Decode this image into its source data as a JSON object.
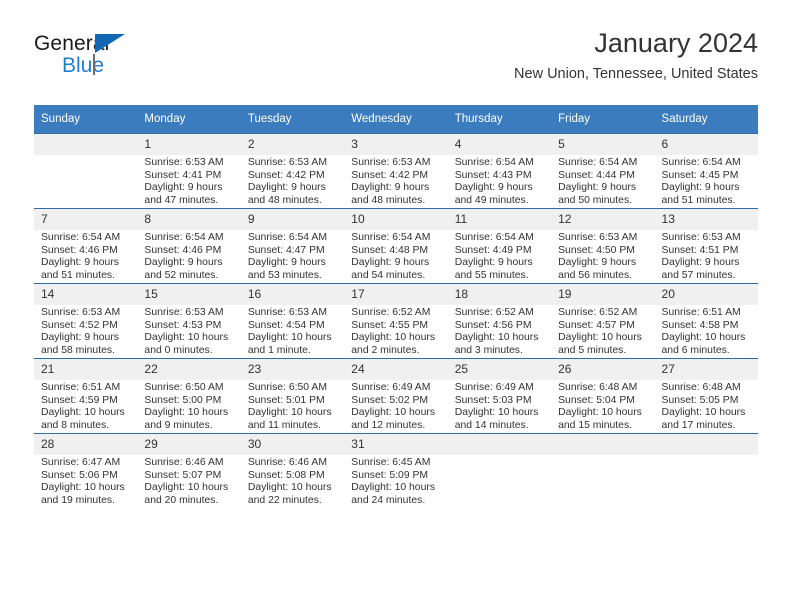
{
  "logo": {
    "word1": "General",
    "word2": "Blue",
    "triangle_color": "#1268b3",
    "blue_color": "#1f7fd0"
  },
  "header": {
    "title": "January 2024",
    "subtitle": "New Union, Tennessee, United States"
  },
  "theme": {
    "header_bg": "#3a7cbe",
    "header_text": "#ffffff",
    "daynum_bg": "#f0f0f0",
    "row_divider": "#2f6ba5",
    "body_text": "#333333"
  },
  "weekdays": [
    "Sunday",
    "Monday",
    "Tuesday",
    "Wednesday",
    "Thursday",
    "Friday",
    "Saturday"
  ],
  "weeks": [
    [
      {
        "day": "",
        "sunrise": "",
        "sunset": "",
        "daylight1": "",
        "daylight2": ""
      },
      {
        "day": "1",
        "sunrise": "Sunrise: 6:53 AM",
        "sunset": "Sunset: 4:41 PM",
        "daylight1": "Daylight: 9 hours",
        "daylight2": "and 47 minutes."
      },
      {
        "day": "2",
        "sunrise": "Sunrise: 6:53 AM",
        "sunset": "Sunset: 4:42 PM",
        "daylight1": "Daylight: 9 hours",
        "daylight2": "and 48 minutes."
      },
      {
        "day": "3",
        "sunrise": "Sunrise: 6:53 AM",
        "sunset": "Sunset: 4:42 PM",
        "daylight1": "Daylight: 9 hours",
        "daylight2": "and 48 minutes."
      },
      {
        "day": "4",
        "sunrise": "Sunrise: 6:54 AM",
        "sunset": "Sunset: 4:43 PM",
        "daylight1": "Daylight: 9 hours",
        "daylight2": "and 49 minutes."
      },
      {
        "day": "5",
        "sunrise": "Sunrise: 6:54 AM",
        "sunset": "Sunset: 4:44 PM",
        "daylight1": "Daylight: 9 hours",
        "daylight2": "and 50 minutes."
      },
      {
        "day": "6",
        "sunrise": "Sunrise: 6:54 AM",
        "sunset": "Sunset: 4:45 PM",
        "daylight1": "Daylight: 9 hours",
        "daylight2": "and 51 minutes."
      }
    ],
    [
      {
        "day": "7",
        "sunrise": "Sunrise: 6:54 AM",
        "sunset": "Sunset: 4:46 PM",
        "daylight1": "Daylight: 9 hours",
        "daylight2": "and 51 minutes."
      },
      {
        "day": "8",
        "sunrise": "Sunrise: 6:54 AM",
        "sunset": "Sunset: 4:46 PM",
        "daylight1": "Daylight: 9 hours",
        "daylight2": "and 52 minutes."
      },
      {
        "day": "9",
        "sunrise": "Sunrise: 6:54 AM",
        "sunset": "Sunset: 4:47 PM",
        "daylight1": "Daylight: 9 hours",
        "daylight2": "and 53 minutes."
      },
      {
        "day": "10",
        "sunrise": "Sunrise: 6:54 AM",
        "sunset": "Sunset: 4:48 PM",
        "daylight1": "Daylight: 9 hours",
        "daylight2": "and 54 minutes."
      },
      {
        "day": "11",
        "sunrise": "Sunrise: 6:54 AM",
        "sunset": "Sunset: 4:49 PM",
        "daylight1": "Daylight: 9 hours",
        "daylight2": "and 55 minutes."
      },
      {
        "day": "12",
        "sunrise": "Sunrise: 6:53 AM",
        "sunset": "Sunset: 4:50 PM",
        "daylight1": "Daylight: 9 hours",
        "daylight2": "and 56 minutes."
      },
      {
        "day": "13",
        "sunrise": "Sunrise: 6:53 AM",
        "sunset": "Sunset: 4:51 PM",
        "daylight1": "Daylight: 9 hours",
        "daylight2": "and 57 minutes."
      }
    ],
    [
      {
        "day": "14",
        "sunrise": "Sunrise: 6:53 AM",
        "sunset": "Sunset: 4:52 PM",
        "daylight1": "Daylight: 9 hours",
        "daylight2": "and 58 minutes."
      },
      {
        "day": "15",
        "sunrise": "Sunrise: 6:53 AM",
        "sunset": "Sunset: 4:53 PM",
        "daylight1": "Daylight: 10 hours",
        "daylight2": "and 0 minutes."
      },
      {
        "day": "16",
        "sunrise": "Sunrise: 6:53 AM",
        "sunset": "Sunset: 4:54 PM",
        "daylight1": "Daylight: 10 hours",
        "daylight2": "and 1 minute."
      },
      {
        "day": "17",
        "sunrise": "Sunrise: 6:52 AM",
        "sunset": "Sunset: 4:55 PM",
        "daylight1": "Daylight: 10 hours",
        "daylight2": "and 2 minutes."
      },
      {
        "day": "18",
        "sunrise": "Sunrise: 6:52 AM",
        "sunset": "Sunset: 4:56 PM",
        "daylight1": "Daylight: 10 hours",
        "daylight2": "and 3 minutes."
      },
      {
        "day": "19",
        "sunrise": "Sunrise: 6:52 AM",
        "sunset": "Sunset: 4:57 PM",
        "daylight1": "Daylight: 10 hours",
        "daylight2": "and 5 minutes."
      },
      {
        "day": "20",
        "sunrise": "Sunrise: 6:51 AM",
        "sunset": "Sunset: 4:58 PM",
        "daylight1": "Daylight: 10 hours",
        "daylight2": "and 6 minutes."
      }
    ],
    [
      {
        "day": "21",
        "sunrise": "Sunrise: 6:51 AM",
        "sunset": "Sunset: 4:59 PM",
        "daylight1": "Daylight: 10 hours",
        "daylight2": "and 8 minutes."
      },
      {
        "day": "22",
        "sunrise": "Sunrise: 6:50 AM",
        "sunset": "Sunset: 5:00 PM",
        "daylight1": "Daylight: 10 hours",
        "daylight2": "and 9 minutes."
      },
      {
        "day": "23",
        "sunrise": "Sunrise: 6:50 AM",
        "sunset": "Sunset: 5:01 PM",
        "daylight1": "Daylight: 10 hours",
        "daylight2": "and 11 minutes."
      },
      {
        "day": "24",
        "sunrise": "Sunrise: 6:49 AM",
        "sunset": "Sunset: 5:02 PM",
        "daylight1": "Daylight: 10 hours",
        "daylight2": "and 12 minutes."
      },
      {
        "day": "25",
        "sunrise": "Sunrise: 6:49 AM",
        "sunset": "Sunset: 5:03 PM",
        "daylight1": "Daylight: 10 hours",
        "daylight2": "and 14 minutes."
      },
      {
        "day": "26",
        "sunrise": "Sunrise: 6:48 AM",
        "sunset": "Sunset: 5:04 PM",
        "daylight1": "Daylight: 10 hours",
        "daylight2": "and 15 minutes."
      },
      {
        "day": "27",
        "sunrise": "Sunrise: 6:48 AM",
        "sunset": "Sunset: 5:05 PM",
        "daylight1": "Daylight: 10 hours",
        "daylight2": "and 17 minutes."
      }
    ],
    [
      {
        "day": "28",
        "sunrise": "Sunrise: 6:47 AM",
        "sunset": "Sunset: 5:06 PM",
        "daylight1": "Daylight: 10 hours",
        "daylight2": "and 19 minutes."
      },
      {
        "day": "29",
        "sunrise": "Sunrise: 6:46 AM",
        "sunset": "Sunset: 5:07 PM",
        "daylight1": "Daylight: 10 hours",
        "daylight2": "and 20 minutes."
      },
      {
        "day": "30",
        "sunrise": "Sunrise: 6:46 AM",
        "sunset": "Sunset: 5:08 PM",
        "daylight1": "Daylight: 10 hours",
        "daylight2": "and 22 minutes."
      },
      {
        "day": "31",
        "sunrise": "Sunrise: 6:45 AM",
        "sunset": "Sunset: 5:09 PM",
        "daylight1": "Daylight: 10 hours",
        "daylight2": "and 24 minutes."
      },
      {
        "day": "",
        "sunrise": "",
        "sunset": "",
        "daylight1": "",
        "daylight2": ""
      },
      {
        "day": "",
        "sunrise": "",
        "sunset": "",
        "daylight1": "",
        "daylight2": ""
      },
      {
        "day": "",
        "sunrise": "",
        "sunset": "",
        "daylight1": "",
        "daylight2": ""
      }
    ]
  ]
}
